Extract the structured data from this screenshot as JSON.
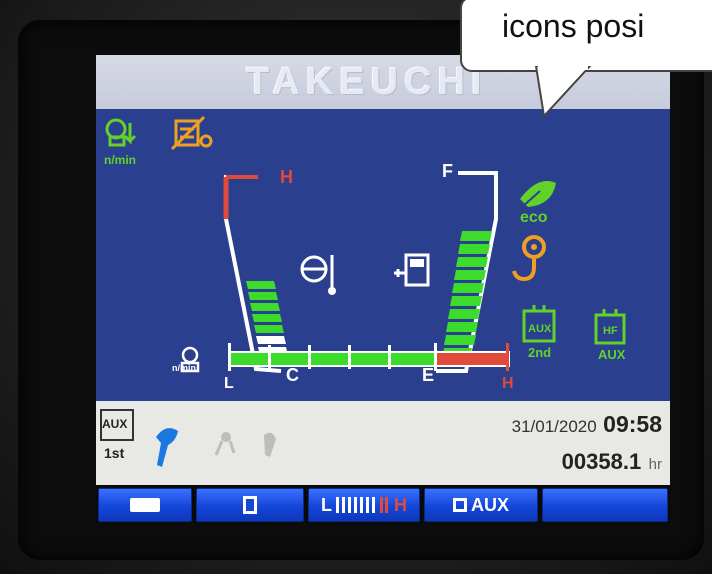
{
  "brand": "TAKEUCHI",
  "callout": {
    "text": "icons posi"
  },
  "temp_gauge": {
    "hot_label": "H",
    "cold_label": "C",
    "level": 0.45
  },
  "fuel_gauge": {
    "full_label": "F",
    "empty_label": "E",
    "level": 0.85
  },
  "rpm_gauge": {
    "low_label": "L",
    "high_label": "H",
    "unit_label": "n/min"
  },
  "left_icons": {
    "engine_speed_label": "n/min"
  },
  "right_icons": {
    "eco_label": "eco",
    "aux_2nd_top": "AUX",
    "aux_2nd_bottom": "2nd",
    "aux_hf_top": "HF",
    "aux_hf_bottom": "AUX"
  },
  "status": {
    "aux_mode_top": "AUX",
    "aux_mode_bottom": "1st",
    "date": "31/01/2020",
    "time": "09:58",
    "hours": "00358.1",
    "hours_unit": "hr"
  },
  "soft_keys": {
    "key3_low": "L",
    "key3_high": "H",
    "key4_label": "AUX"
  },
  "colors": {
    "screen_bg": "#2b3f8f",
    "gauge_green": "#3ddb2c",
    "gauge_red": "#e04a3a",
    "icon_green": "#62d22a",
    "icon_orange": "#f0a020"
  }
}
